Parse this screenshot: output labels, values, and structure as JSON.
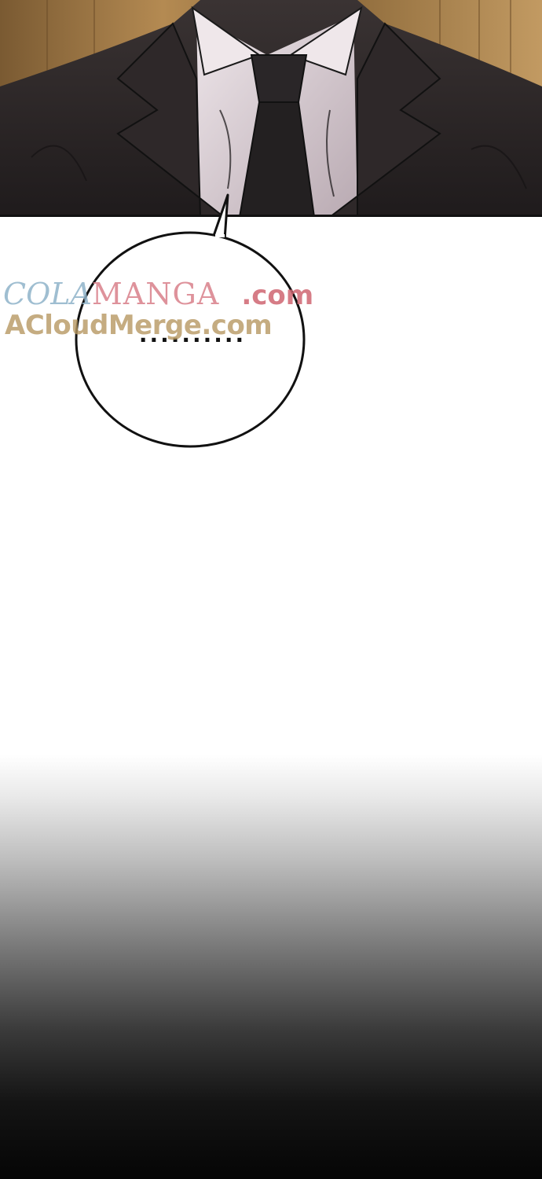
{
  "panel": {
    "bubble_text": "..........",
    "scene_icon": "suited-man-illustration-icon"
  },
  "watermark": {
    "line1_part1": "COLA",
    "line1_part2": "MANGA",
    "line1_part3": ".com",
    "line2": "ACloudMerge.com"
  },
  "colors": {
    "suit": "#2b2626",
    "shirt": "#d8cdd1",
    "tie": "#221f21",
    "background_wood": "#a07a45",
    "watermark_blue": "#8fb3c9",
    "watermark_pink": "#d9808a",
    "watermark_gold": "#b79862"
  }
}
